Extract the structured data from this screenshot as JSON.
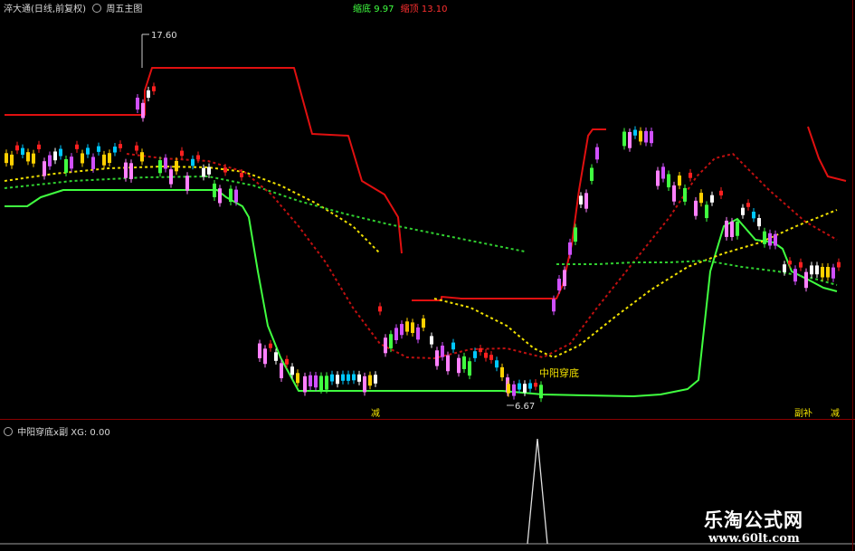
{
  "header": {
    "title": "淬大通(日线,前复权)",
    "indicator": "周五主图",
    "left_label": "缩底",
    "left_value": "9.97",
    "right_label": "缩顶",
    "right_value": "13.10"
  },
  "sub_header": {
    "title": "中阳穿底x副 XG: 0.00"
  },
  "annotations": {
    "high_price": "17.60",
    "low_price": "6.67",
    "signal": "中阳穿底",
    "marker_left": "减",
    "marker_right1": "副补",
    "marker_right2": "减"
  },
  "watermark": {
    "line1": "乐淘公式网",
    "line2": "www.60lt.com"
  },
  "colors": {
    "background": "#000000",
    "up": "#ff2020",
    "down": "#00c8ff",
    "support": "#40ff40",
    "resistance": "#e01010",
    "dotted_yellow": "#f0e000",
    "dotted_red": "#c01010",
    "dotted_green": "#30d030"
  }
}
